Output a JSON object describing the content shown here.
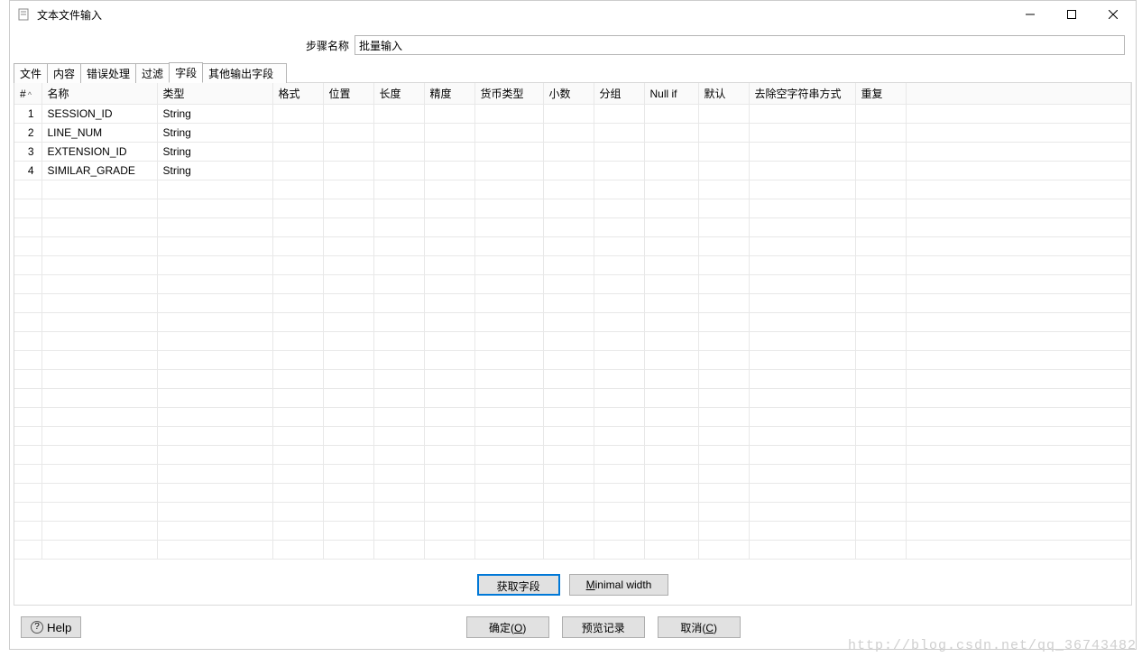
{
  "window": {
    "title": "文本文件输入"
  },
  "step": {
    "label": "步骤名称",
    "value": "批量输入"
  },
  "tabs": [
    {
      "label": "文件"
    },
    {
      "label": "内容"
    },
    {
      "label": "错误处理"
    },
    {
      "label": "过滤"
    },
    {
      "label": "字段",
      "active": true
    },
    {
      "label": "其他输出字段"
    }
  ],
  "columns": {
    "num": "#",
    "name": "名称",
    "type": "类型",
    "format": "格式",
    "position": "位置",
    "length": "长度",
    "precision": "精度",
    "currency": "货币类型",
    "decimal": "小数",
    "group": "分组",
    "null_if": "Null if",
    "default": "默认",
    "trim": "去除空字符串方式",
    "repeat": "重复"
  },
  "rows": [
    {
      "num": "1",
      "name": "SESSION_ID",
      "type": "String"
    },
    {
      "num": "2",
      "name": "LINE_NUM",
      "type": "String"
    },
    {
      "num": "3",
      "name": "EXTENSION_ID",
      "type": "String"
    },
    {
      "num": "4",
      "name": "SIMILAR_GRADE",
      "type": "String"
    }
  ],
  "buttons": {
    "get_fields": "获取字段",
    "min_width_pre": "M",
    "min_width_rest": "inimal width",
    "ok_pre": "确定(",
    "ok_key": "O",
    "ok_post": ")",
    "preview": "预览记录",
    "cancel_pre": "取消(",
    "cancel_key": "C",
    "cancel_post": ")",
    "help": "Help"
  },
  "watermark": "http://blog.csdn.net/qq_36743482"
}
